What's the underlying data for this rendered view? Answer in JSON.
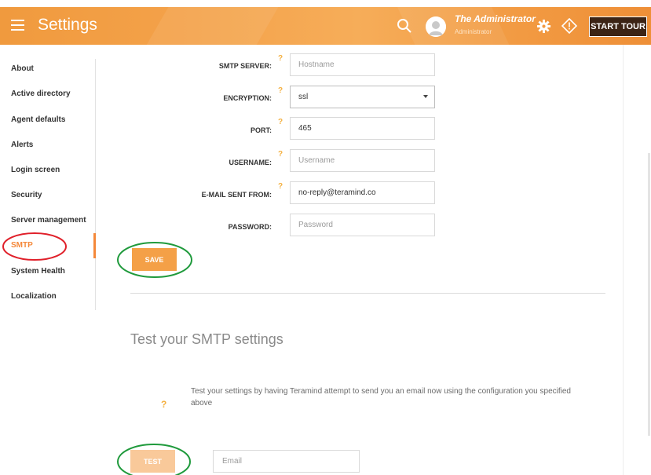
{
  "header": {
    "title": "Settings",
    "user_name": "The Administrator",
    "user_role": "Administrator",
    "start_tour_label": "START TOUR",
    "icons": [
      "menu-icon",
      "search-icon",
      "avatar",
      "gear-icon",
      "tour-icon"
    ]
  },
  "sidebar": {
    "items": [
      {
        "label": "About"
      },
      {
        "label": "Active directory"
      },
      {
        "label": "Agent defaults"
      },
      {
        "label": "Alerts"
      },
      {
        "label": "Login screen"
      },
      {
        "label": "Security"
      },
      {
        "label": "Server management"
      },
      {
        "label": "SMTP",
        "active": true
      },
      {
        "label": "System Health"
      },
      {
        "label": "Localization"
      }
    ],
    "active_color": "#f4883a"
  },
  "smtp_form": {
    "server_label": "SMTP SERVER:",
    "server_placeholder": "Hostname",
    "encryption_label": "ENCRYPTION:",
    "encryption_value": "ssl",
    "port_label": "PORT:",
    "port_value": "465",
    "username_label": "USERNAME:",
    "username_placeholder": "Username",
    "from_label": "E-MAIL SENT FROM:",
    "from_value": "no-reply@teramind.co",
    "password_label": "PASSWORD:",
    "password_placeholder": "Password",
    "help_mark": "?",
    "save_label": "SAVE"
  },
  "test_section": {
    "title": "Test your SMTP settings",
    "description": "Test your settings by having Teramind attempt to send you an email now using the configuration you specified above",
    "help_mark": "?",
    "test_label": "TEST",
    "email_placeholder": "Email"
  },
  "colors": {
    "accent": "#f4a047",
    "header": "#f4a24a",
    "help": "#f4b041",
    "annotation_red": "#e0202a",
    "annotation_green": "#1f9a3c"
  }
}
